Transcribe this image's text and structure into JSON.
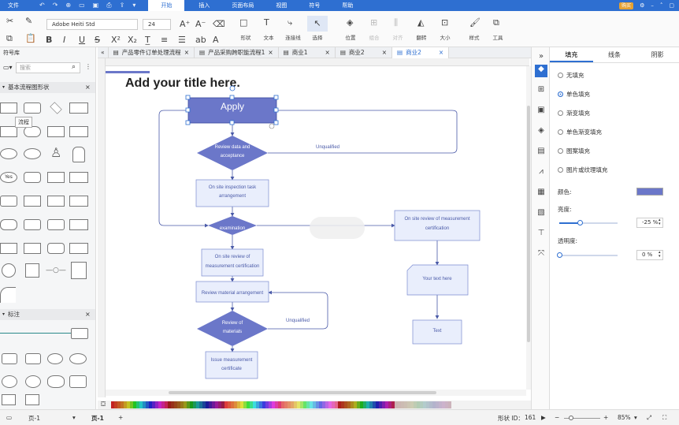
{
  "menubar": {
    "items": [
      "文件",
      "开始",
      "插入",
      "页面布局",
      "视图",
      "符号",
      "帮助"
    ],
    "active_index": 1,
    "buy_label": "购买"
  },
  "ribbon": {
    "font_name": "Adobe Heiti Std",
    "font_size": "24",
    "tools": {
      "shape": "形状",
      "text": "文本",
      "connector": "连接线",
      "select": "选择",
      "position": "位置",
      "combine": "组合",
      "align": "对齐",
      "flip": "翻转",
      "size": "大小",
      "style": "样式",
      "tools": "工具"
    }
  },
  "tabs": [
    {
      "label": "产品零件订单处理流程"
    },
    {
      "label": "产品采购跨职能流程1"
    },
    {
      "label": "商业1"
    },
    {
      "label": "商业2"
    },
    {
      "label": "商业2",
      "active": true
    }
  ],
  "left_panel": {
    "title": "符号库",
    "search_placeholder": "搜索",
    "section1": "基本流程图形状",
    "tooltip": "流程",
    "section2": "标注"
  },
  "canvas": {
    "title": "Add your title here.",
    "nodes": {
      "apply": "Apply",
      "review_acceptance": [
        "Review data and",
        "acceptance"
      ],
      "unqualified1": "Unqualified",
      "onsite_task": [
        "On site inspection task",
        "arrangement"
      ],
      "diamond2": [
        "examination"
      ],
      "onsite_cert_right": [
        "On site review of measurement",
        "certification"
      ],
      "onsite_cert_left": [
        "On site review of",
        "measurement certification"
      ],
      "review_material_arr": "Review material arrangement",
      "review_materials": [
        "Review of",
        "materials"
      ],
      "unqualified2": "Unqualified",
      "issue_cert": [
        "Issue measurement",
        "certificate"
      ],
      "your_text": "Your text here",
      "text_box": "Text"
    }
  },
  "right_panel": {
    "tabs": [
      "填充",
      "线条",
      "阴影"
    ],
    "options": [
      "无填充",
      "单色填充",
      "渐变填充",
      "单色渐变填充",
      "图案填充",
      "图片或纹理填充"
    ],
    "selected_option": 1,
    "color_label": "颜色:",
    "color_value": "#6b77c9",
    "brightness_label": "亮度:",
    "brightness_value": "-25 %",
    "brightness_level": 0.35,
    "transparency_label": "透明度:",
    "transparency_value": "0 %",
    "transparency_level": 0.0
  },
  "statusbar": {
    "page_select": "页-1",
    "page_tab": "页-1",
    "shape_id_label": "形状 ID：",
    "shape_id": "161",
    "zoom": "85%"
  }
}
